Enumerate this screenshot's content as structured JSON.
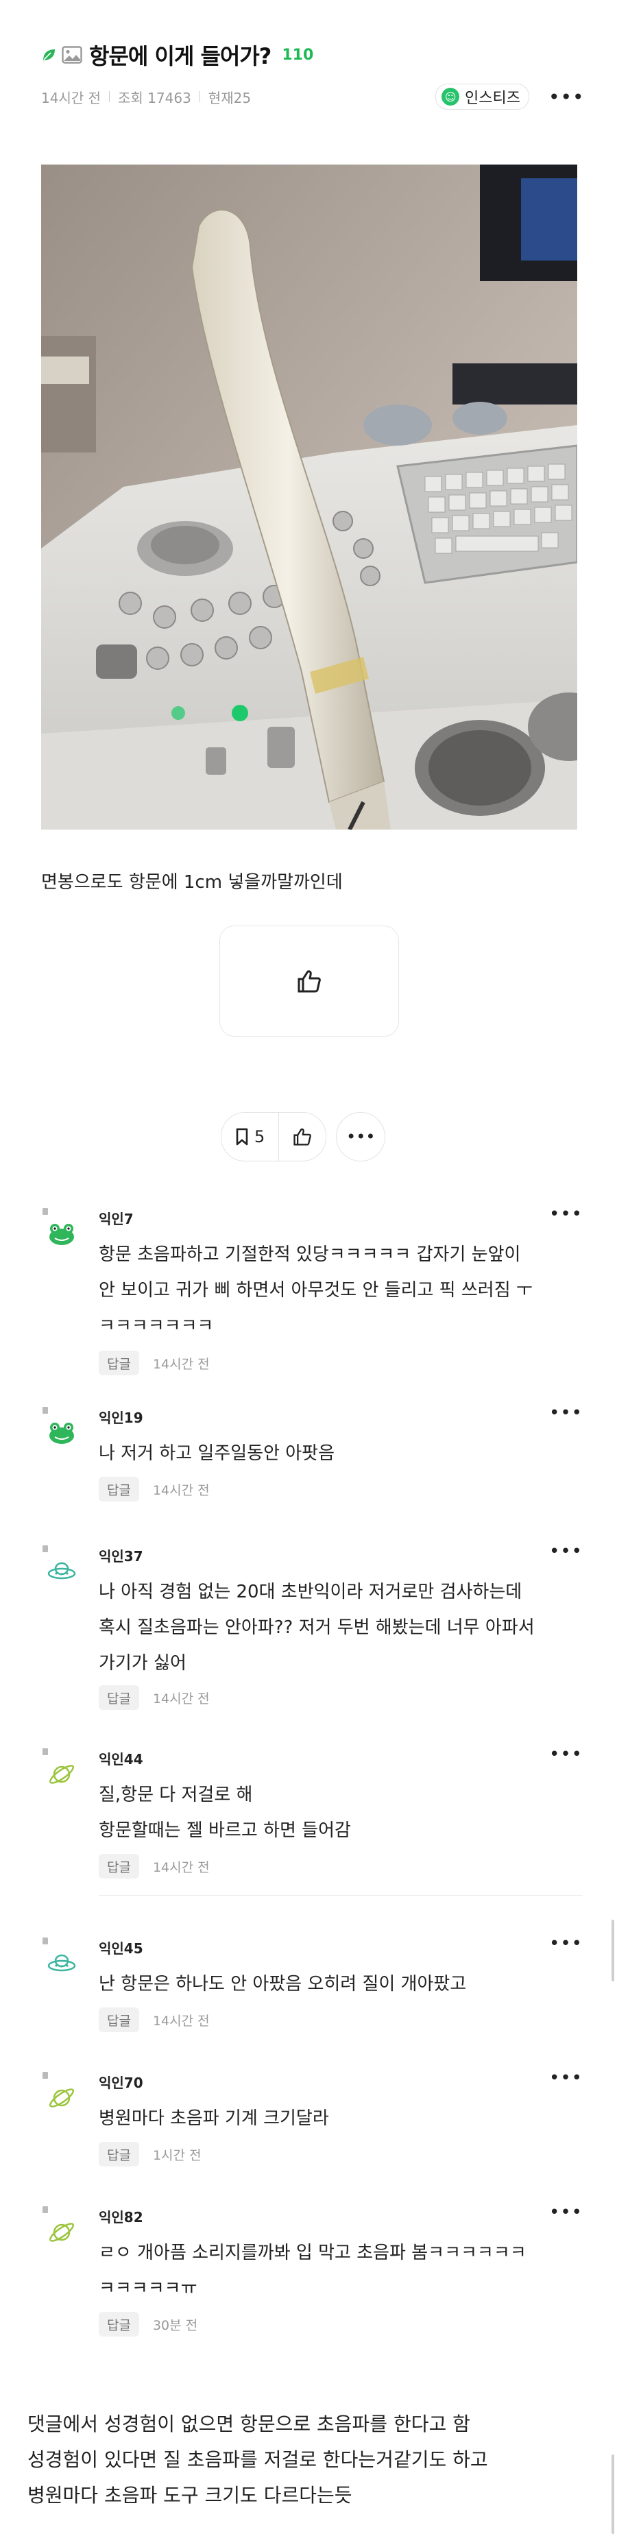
{
  "post": {
    "title": "항문에 이게 들어가?",
    "comment_count": "110",
    "time_ago": "14시간 전",
    "views": "조회 17463",
    "current": "현재25",
    "board": "인스티즈",
    "body": "면봉으로도 항문에 1cm 넣을까말까인데"
  },
  "actions": {
    "bookmark_count": "5",
    "more": "•••"
  },
  "comments": [
    {
      "author": "익인7",
      "avatar": "frog",
      "lines": [
        "항문 초음파하고 기절한적 있당ㅋㅋㅋㅋㅋ 갑자기 눈앞이",
        "안 보이고 귀가 삐 하면서 아무것도 안 들리고 픽 쓰러짐 ㅜ",
        "ㅋㅋㅋㅋㅋㅋㅋ"
      ],
      "reply": "답글",
      "time": "14시간 전"
    },
    {
      "author": "익인19",
      "avatar": "frog",
      "lines": [
        "나 저거 하고 일주일동안 아팟음"
      ],
      "reply": "답글",
      "time": "14시간 전"
    },
    {
      "author": "익인37",
      "avatar": "ufo",
      "lines": [
        "나 아직 경험 없는 20대 초반익이라 저거로만 검사하는데",
        "혹시 질초음파는 안아파?? 저거 두번 해봤는데 너무 아파서",
        "가기가 싫어"
      ],
      "reply": "답글",
      "time": "14시간 전"
    },
    {
      "author": "익인44",
      "avatar": "planet",
      "lines": [
        "질,항문 다 저걸로 해",
        "항문할때는 젤 바르고 하면 들어감"
      ],
      "reply": "답글",
      "time": "14시간 전"
    },
    {
      "author": "익인45",
      "avatar": "ufo",
      "lines": [
        "난 항문은 하나도 안 아팠음 오히려 질이 개아팠고"
      ],
      "reply": "답글",
      "time": "14시간 전"
    },
    {
      "author": "익인70",
      "avatar": "planet",
      "lines": [
        "병원마다 초음파 기계 크기달라"
      ],
      "reply": "답글",
      "time": "1시간 전"
    },
    {
      "author": "익인82",
      "avatar": "planet",
      "lines": [
        "ㄹㅇ 개아픔 소리지를까봐 입 막고 초음파 봄ㅋㅋㅋㅋㅋㅋ",
        "ㅋㅋㅋㅋㅋㅠ"
      ],
      "reply": "답글",
      "time": "30분 전"
    }
  ],
  "footer": {
    "lines": [
      "댓글에서 성경험이 없으면 항문으로 초음파를 한다고 함",
      "성경험이 있다면 질 초음파를 저걸로 한다는거같기도 하고",
      "병원마다 초음파 도구 크기도 다르다는듯"
    ]
  },
  "colors": {
    "accent_green": "#1db954",
    "frog_green": "#2fb55a",
    "ufo_teal": "#3bb5a0",
    "planet_lime": "#9bc53d"
  }
}
